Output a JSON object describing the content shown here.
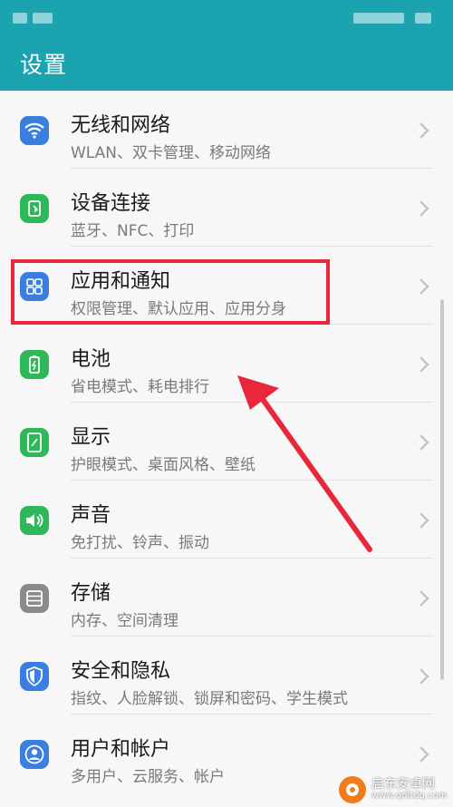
{
  "header": {
    "title": "设置"
  },
  "colors": {
    "accent": "#1ba4b0",
    "highlight": "#e8283a"
  },
  "settings": [
    {
      "title": "无线和网络",
      "subtitle": "WLAN、双卡管理、移动网络",
      "icon": "wifi-icon",
      "color": "#3a7ee0"
    },
    {
      "title": "设备连接",
      "subtitle": "蓝牙、NFC、打印",
      "icon": "device-connection-icon",
      "color": "#2fb85a"
    },
    {
      "title": "应用和通知",
      "subtitle": "权限管理、默认应用、应用分身",
      "icon": "apps-grid-icon",
      "color": "#3a7ee0"
    },
    {
      "title": "电池",
      "subtitle": "省电模式、耗电排行",
      "icon": "battery-icon",
      "color": "#2fb85a"
    },
    {
      "title": "显示",
      "subtitle": "护眼模式、桌面风格、壁纸",
      "icon": "display-icon",
      "color": "#2fb85a"
    },
    {
      "title": "声音",
      "subtitle": "免打扰、铃声、振动",
      "icon": "speaker-icon",
      "color": "#2fb85a"
    },
    {
      "title": "存储",
      "subtitle": "内存、空间清理",
      "icon": "storage-icon",
      "color": "#8a8a8a"
    },
    {
      "title": "安全和隐私",
      "subtitle": "指纹、人脸解锁、锁屏和密码、学生模式",
      "icon": "shield-icon",
      "color": "#3a7ee0"
    },
    {
      "title": "用户和帐户",
      "subtitle": "多用户、云服务、帐户",
      "icon": "user-icon",
      "color": "#3a7ee0"
    }
  ],
  "watermark": {
    "name": "启东安卓网",
    "url": "www.qdltdq.com"
  }
}
